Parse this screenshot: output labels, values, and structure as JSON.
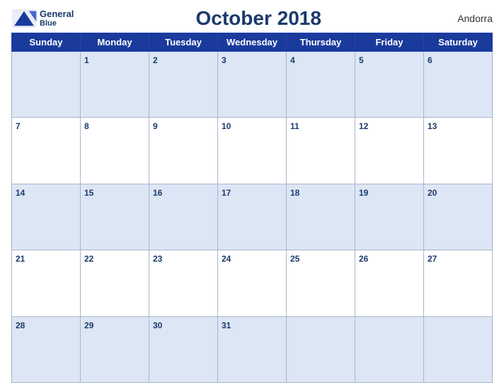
{
  "header": {
    "logo_general": "General",
    "logo_blue": "Blue",
    "title": "October 2018",
    "country": "Andorra"
  },
  "weekdays": [
    "Sunday",
    "Monday",
    "Tuesday",
    "Wednesday",
    "Thursday",
    "Friday",
    "Saturday"
  ],
  "weeks": [
    [
      null,
      1,
      2,
      3,
      4,
      5,
      6
    ],
    [
      7,
      8,
      9,
      10,
      11,
      12,
      13
    ],
    [
      14,
      15,
      16,
      17,
      18,
      19,
      20
    ],
    [
      21,
      22,
      23,
      24,
      25,
      26,
      27
    ],
    [
      28,
      29,
      30,
      31,
      null,
      null,
      null
    ]
  ]
}
